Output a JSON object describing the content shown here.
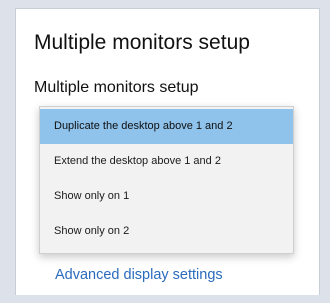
{
  "section": {
    "title": "Multiple monitors setup"
  },
  "monitor_select": {
    "label": "Multiple monitors setup",
    "options": [
      "Duplicate the desktop above 1 and 2",
      "Extend the desktop above 1 and 2",
      "Show only on 1",
      "Show only on 2"
    ],
    "selected": "Duplicate the desktop above 1 and 2",
    "highlight_color": "#8fc3ec"
  },
  "links": {
    "advanced": "Advanced display settings",
    "link_color": "#2a6bbd"
  }
}
